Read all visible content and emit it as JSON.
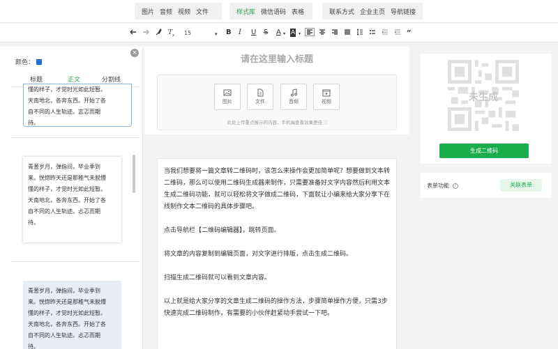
{
  "topnav": {
    "group1": [
      "图片",
      "音频",
      "视频",
      "文件"
    ],
    "group2": [
      "样式库",
      "微信语码",
      "表格"
    ],
    "group3": [
      "联系方式",
      "企业主页",
      "导航链接"
    ]
  },
  "toolbar": {
    "font_size": "15",
    "buttons": [
      "undo-icon",
      "redo-icon",
      "format-brush-icon",
      "clear-format-icon",
      "bold-icon",
      "italic-icon",
      "underline-icon",
      "strikethrough-icon",
      "font-color-icon",
      "highlight-icon",
      "align-left-icon",
      "align-center-icon",
      "align-right-icon",
      "align-justify-icon",
      "line-height-icon",
      "unordered-list-icon",
      "ordered-list-icon",
      "quote-icon"
    ],
    "bold": "B",
    "italic": "I",
    "underline": "U",
    "strike": "S",
    "font_color": "A",
    "highlight": "A",
    "quote": "99"
  },
  "left": {
    "color_label": "颜色：",
    "swatch_color": "#1f6fd1",
    "close": "×",
    "tabs": [
      "标题",
      "正文",
      "分割线"
    ],
    "card1": [
      "懂的样子，才觉时光如此短暂。",
      "天南地北，各奔东西。开始了各",
      "自不同的人生轨迹。志忑而期",
      "待。"
    ],
    "card2": [
      "青葱岁月，弹指间，毕业季到",
      "来。恍惚昨天还是那稚气未脱懵",
      "懂的样子，才觉时光如此短暂。",
      "天南地北，各奔东西。开始了各",
      "自不同的人生轨迹。忐忑而期",
      "待。"
    ],
    "card3": [
      "青葱岁月，弹指间，毕业季到",
      "来。恍惚昨天还是那稚气未脱懵",
      "懂的样子，才觉时光如此短暂。",
      "天南地北，各奔东西。开始了各",
      "自不同的人生轨迹。忐忑而期",
      "待。"
    ]
  },
  "center": {
    "title_placeholder": "请在这里输入标题",
    "upload_buttons": [
      "图片",
      "文件",
      "音频",
      "视频"
    ],
    "upload_hint": "此处上传重点展示的内容，手机端查看效果更佳 ⓘ",
    "paragraphs": [
      "当我们想要将一篇文章转二维码时，该怎么来操作会更加简单呢？想要做到文本转二维码，那么可以使用二维码生成器来制作，只需要准备好文字内容然后利用文本生成二维码功能，就可以轻松将文字做成二维码，下面就让小编来给大家分享下在线制作文本二维码的具体步骤吧。",
      "点击导航栏【二维码编辑器】，跳转页面。",
      "将文章的内容复制到编辑页面，对文字进行排版，点击生成二维码。",
      "扫描生成二维码就可以看到文章内容。",
      "以上就是给大家分享的文章生成二维码的操作方法，步骤简单操作方便，只需3步快速完成二维码制作，有需要的小伙伴赶紧动手尝试一下吧。"
    ]
  },
  "right": {
    "qr_overlay": "未生成",
    "generate_button": "生成二维码",
    "form_label": "表单功能",
    "help": "?",
    "link_form_button": "关联表单",
    "accent": "#1aad4b"
  }
}
